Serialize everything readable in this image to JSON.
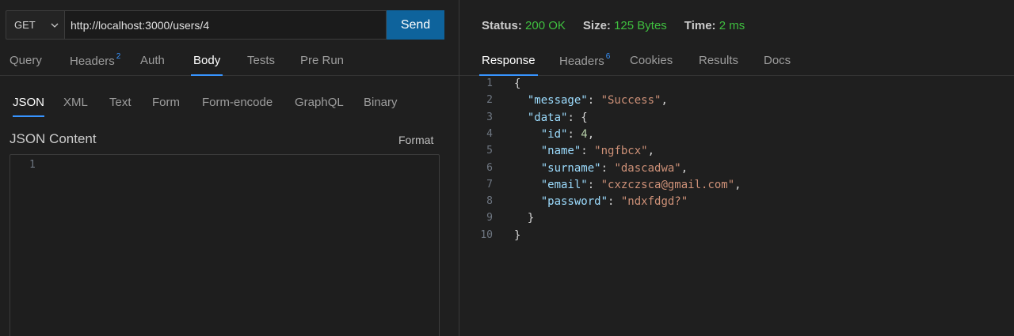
{
  "request": {
    "method": "GET",
    "url": "http://localhost:3000/users/4",
    "send_label": "Send"
  },
  "request_tabs": [
    {
      "label": "Query"
    },
    {
      "label": "Headers",
      "badge": "2"
    },
    {
      "label": "Auth"
    },
    {
      "label": "Body",
      "active": true
    },
    {
      "label": "Tests"
    },
    {
      "label": "Pre Run"
    }
  ],
  "body_tabs": [
    {
      "label": "JSON",
      "active": true
    },
    {
      "label": "XML"
    },
    {
      "label": "Text"
    },
    {
      "label": "Form"
    },
    {
      "label": "Form-encode"
    },
    {
      "label": "GraphQL"
    },
    {
      "label": "Binary"
    }
  ],
  "body": {
    "title": "JSON Content",
    "format_label": "Format",
    "line_number": "1"
  },
  "status": {
    "status_label": "Status:",
    "status_value": "200 OK",
    "size_label": "Size:",
    "size_value": "125 Bytes",
    "time_label": "Time:",
    "time_value": "2 ms"
  },
  "response_tabs": [
    {
      "label": "Response",
      "active": true
    },
    {
      "label": "Headers",
      "badge": "6"
    },
    {
      "label": "Cookies"
    },
    {
      "label": "Results"
    },
    {
      "label": "Docs"
    }
  ],
  "response_lines": [
    {
      "num": "1",
      "indent": "",
      "parts": [
        [
          "p",
          "{"
        ]
      ]
    },
    {
      "num": "2",
      "indent": "  ",
      "parts": [
        [
          "k",
          "\"message\""
        ],
        [
          "p",
          ": "
        ],
        [
          "s",
          "\"Success\""
        ],
        [
          "p",
          ","
        ]
      ]
    },
    {
      "num": "3",
      "indent": "  ",
      "parts": [
        [
          "k",
          "\"data\""
        ],
        [
          "p",
          ": {"
        ]
      ]
    },
    {
      "num": "4",
      "indent": "    ",
      "parts": [
        [
          "k",
          "\"id\""
        ],
        [
          "p",
          ": "
        ],
        [
          "n",
          "4"
        ],
        [
          "p",
          ","
        ]
      ]
    },
    {
      "num": "5",
      "indent": "    ",
      "parts": [
        [
          "k",
          "\"name\""
        ],
        [
          "p",
          ": "
        ],
        [
          "s",
          "\"ngfbcx\""
        ],
        [
          "p",
          ","
        ]
      ]
    },
    {
      "num": "6",
      "indent": "    ",
      "parts": [
        [
          "k",
          "\"surname\""
        ],
        [
          "p",
          ": "
        ],
        [
          "s",
          "\"dascadwa\""
        ],
        [
          "p",
          ","
        ]
      ]
    },
    {
      "num": "7",
      "indent": "    ",
      "parts": [
        [
          "k",
          "\"email\""
        ],
        [
          "p",
          ": "
        ],
        [
          "s",
          "\"cxzczsca@gmail.com\""
        ],
        [
          "p",
          ","
        ]
      ]
    },
    {
      "num": "8",
      "indent": "    ",
      "parts": [
        [
          "k",
          "\"password\""
        ],
        [
          "p",
          ": "
        ],
        [
          "s",
          "\"ndxfdgd?\""
        ]
      ]
    },
    {
      "num": "9",
      "indent": "  ",
      "parts": [
        [
          "p",
          "}"
        ]
      ]
    },
    {
      "num": "10",
      "indent": "",
      "parts": [
        [
          "p",
          "}"
        ]
      ]
    }
  ],
  "colors": {
    "accent": "#3794ff",
    "send_button": "#0e639c",
    "status_ok": "#3fbf3f",
    "json_key": "#9cdcfe",
    "json_string": "#ce9178",
    "json_number": "#b5cea8"
  }
}
